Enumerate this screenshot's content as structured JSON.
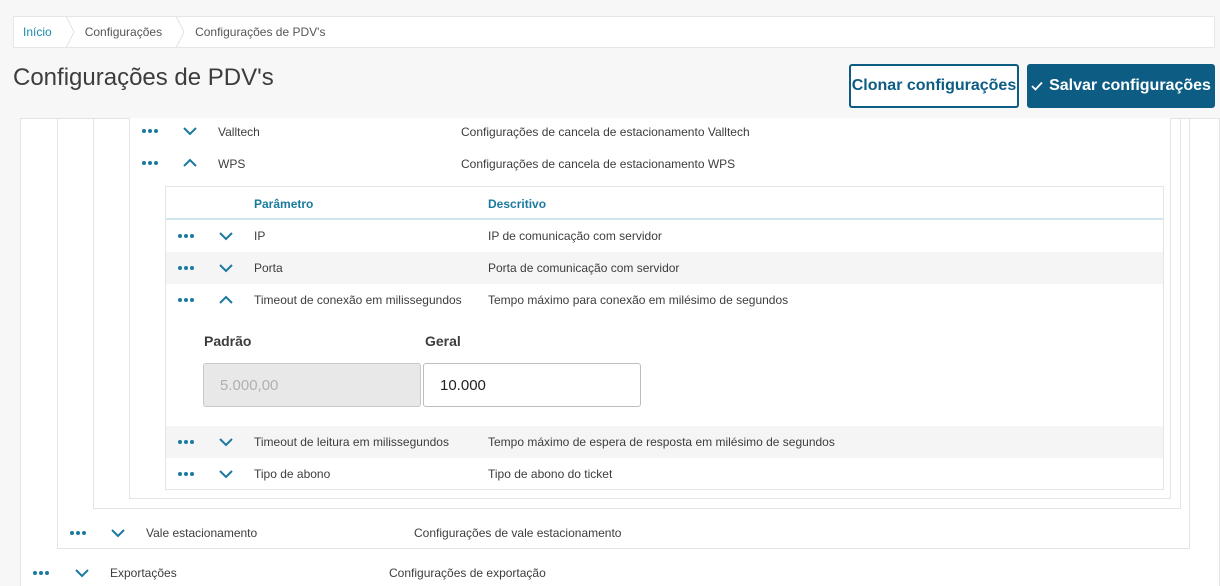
{
  "breadcrumb": [
    "Início",
    "Configurações",
    "Configurações de PDV's"
  ],
  "page_title": "Configurações de PDV's",
  "buttons": {
    "clone": "Clonar configurações",
    "save": "Salvar configurações"
  },
  "level2_rows": [
    {
      "name": "Valltech",
      "desc": "Configurações de cancela de estacionamento Valltech"
    },
    {
      "name": "WPS",
      "desc": "Configurações de cancela de estacionamento WPS"
    }
  ],
  "table": {
    "headers": [
      "Parâmetro",
      "Descritivo"
    ]
  },
  "params": [
    {
      "name": "IP",
      "desc": "IP de comunicação com servidor"
    },
    {
      "name": "Porta",
      "desc": "Porta de comunicação com servidor"
    },
    {
      "name": "Timeout de conexão em milissegundos",
      "desc": "Tempo máximo para conexão em milésimo de segundos"
    },
    {
      "name": "Timeout de leitura em milissegundos",
      "desc": "Tempo máximo de espera de resposta em milésimo de segundos"
    },
    {
      "name": "Tipo de abono",
      "desc": "Tipo de abono do ticket"
    }
  ],
  "detail": {
    "default_label": "Padrão",
    "default_value": "5.000,00",
    "general_label": "Geral",
    "general_value": "10.000"
  },
  "level1_row": {
    "name": "Vale estacionamento",
    "desc": "Configurações de vale estacionamento"
  },
  "level0_row": {
    "name": "Exportações",
    "desc": "Configurações de exportação"
  },
  "colors": {
    "accent": "#0c5c84",
    "link": "#1a7aa0"
  }
}
